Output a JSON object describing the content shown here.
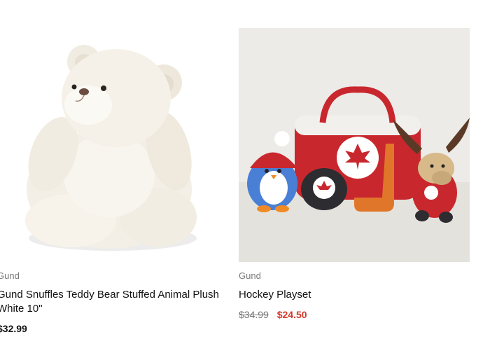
{
  "products": [
    {
      "brand": "Gund",
      "name": "Gund Snuffles Teddy Bear Stuffed Animal Plush White 10\"",
      "price": "$32.99",
      "image_icon": "teddy-bear-image"
    },
    {
      "brand": "Gund",
      "name": "Hockey Playset",
      "price_original": "$34.99",
      "price_sale": "$24.50",
      "image_icon": "hockey-playset-image"
    }
  ],
  "colors": {
    "sale": "#d33a2c",
    "brand_text": "#7a7a7a",
    "image_bg": "#ecebe7"
  }
}
